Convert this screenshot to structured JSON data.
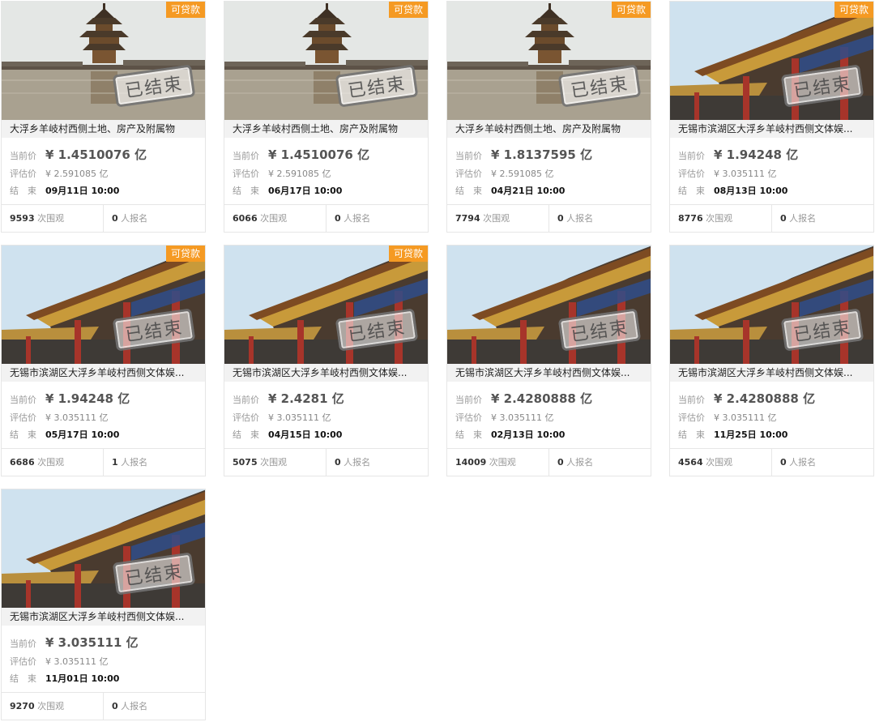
{
  "labels": {
    "current_price": "当前价",
    "eval_price": "评估价",
    "end": "结　束",
    "views_suffix": "次围观",
    "signups_suffix": "人报名",
    "ended_stamp": "已结束",
    "loan_tag": "可贷款"
  },
  "colors": {
    "loan_tag": "#f59a23",
    "border": "#e6e6e6",
    "title_bg": "#f2f2f2"
  },
  "cards": [
    {
      "image": "lake-pavilion",
      "loan": true,
      "title": "大浮乡羊岐村西侧土地、房产及附属物",
      "current_price": "¥ 1.4510076 亿",
      "eval_price": "¥ 2.591085 亿",
      "end_time": "09月11日 10:00",
      "views": "9593",
      "signups": "0"
    },
    {
      "image": "lake-pavilion",
      "loan": true,
      "title": "大浮乡羊岐村西侧土地、房产及附属物",
      "current_price": "¥ 1.4510076 亿",
      "eval_price": "¥ 2.591085 亿",
      "end_time": "06月17日 10:00",
      "views": "6066",
      "signups": "0"
    },
    {
      "image": "lake-pavilion",
      "loan": true,
      "title": "大浮乡羊岐村西侧土地、房产及附属物",
      "current_price": "¥ 1.8137595 亿",
      "eval_price": "¥ 2.591085 亿",
      "end_time": "04月21日 10:00",
      "views": "7794",
      "signups": "0"
    },
    {
      "image": "temple-gate",
      "loan": true,
      "title": "无锡市滨湖区大浮乡羊岐村西侧文体娱...",
      "current_price": "¥ 1.94248 亿",
      "eval_price": "¥ 3.035111 亿",
      "end_time": "08月13日 10:00",
      "views": "8776",
      "signups": "0"
    },
    {
      "image": "temple-gate",
      "loan": true,
      "title": "无锡市滨湖区大浮乡羊岐村西侧文体娱...",
      "current_price": "¥ 1.94248 亿",
      "eval_price": "¥ 3.035111 亿",
      "end_time": "05月17日 10:00",
      "views": "6686",
      "signups": "1"
    },
    {
      "image": "temple-gate",
      "loan": true,
      "title": "无锡市滨湖区大浮乡羊岐村西侧文体娱...",
      "current_price": "¥ 2.4281 亿",
      "eval_price": "¥ 3.035111 亿",
      "end_time": "04月15日 10:00",
      "views": "5075",
      "signups": "0"
    },
    {
      "image": "temple-gate",
      "loan": false,
      "title": "无锡市滨湖区大浮乡羊岐村西侧文体娱...",
      "current_price": "¥ 2.4280888 亿",
      "eval_price": "¥ 3.035111 亿",
      "end_time": "02月13日 10:00",
      "views": "14009",
      "signups": "0"
    },
    {
      "image": "temple-gate",
      "loan": false,
      "title": "无锡市滨湖区大浮乡羊岐村西侧文体娱...",
      "current_price": "¥ 2.4280888 亿",
      "eval_price": "¥ 3.035111 亿",
      "end_time": "11月25日 10:00",
      "views": "4564",
      "signups": "0"
    },
    {
      "image": "temple-gate",
      "loan": false,
      "title": "无锡市滨湖区大浮乡羊岐村西侧文体娱...",
      "current_price": "¥ 3.035111 亿",
      "eval_price": "¥ 3.035111 亿",
      "end_time": "11月01日 10:00",
      "views": "9270",
      "signups": "0"
    }
  ]
}
